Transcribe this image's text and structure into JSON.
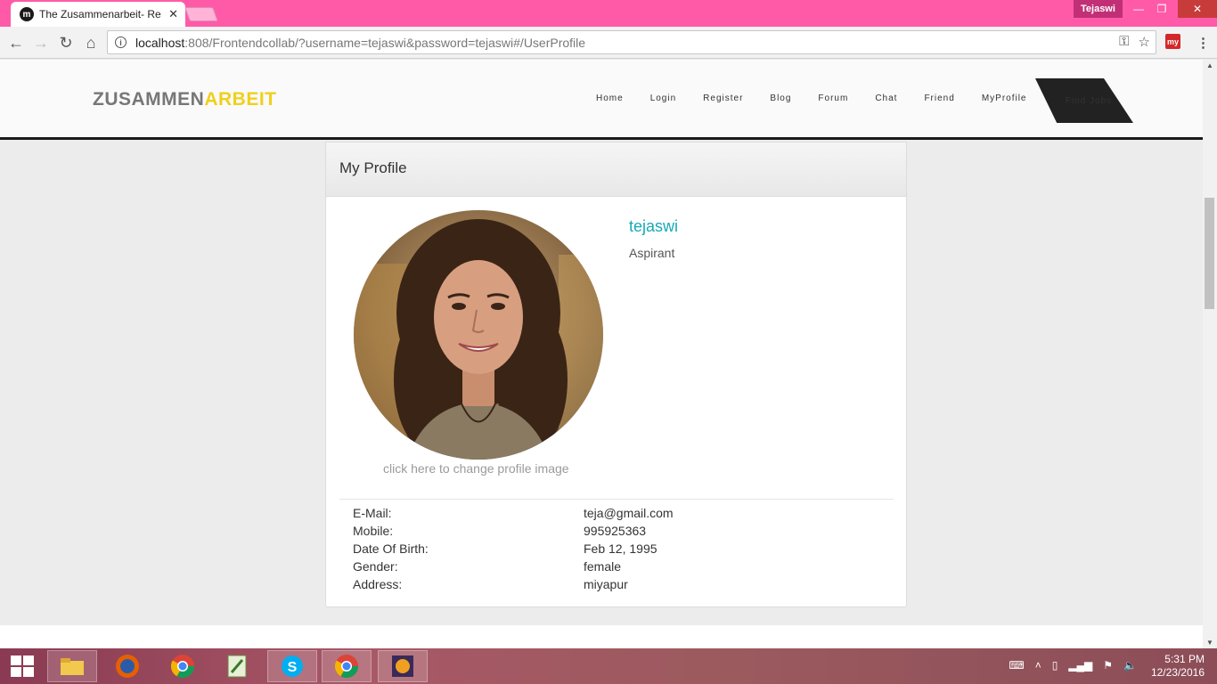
{
  "browser": {
    "tab_title": "The Zusammenarbeit- Re",
    "profile_name": "Tejaswi",
    "url_host": "localhost",
    "url_rest": ":808/Frontendcollab/?username=tejaswi&password=tejaswi#/UserProfile",
    "extension_label": "my"
  },
  "site": {
    "brand_part1": "ZUSAMMEN",
    "brand_part2": "ARBEIT",
    "nav": [
      "Home",
      "Login",
      "Register",
      "Blog",
      "Forum",
      "Chat",
      "Friend",
      "MyProfile"
    ],
    "find_jobs": "Find Jobs"
  },
  "profile": {
    "header": "My Profile",
    "username": "tejaswi",
    "role": "Aspirant",
    "change_image": "click here to change profile image",
    "details": [
      {
        "label": "E-Mail:",
        "value": "teja@gmail.com"
      },
      {
        "label": "Mobile:",
        "value": "995925363"
      },
      {
        "label": "Date Of Birth:",
        "value": "Feb 12, 1995"
      },
      {
        "label": "Gender:",
        "value": "female"
      },
      {
        "label": "Address:",
        "value": "miyapur"
      }
    ]
  },
  "taskbar": {
    "time": "5:31 PM",
    "date": "12/23/2016"
  }
}
